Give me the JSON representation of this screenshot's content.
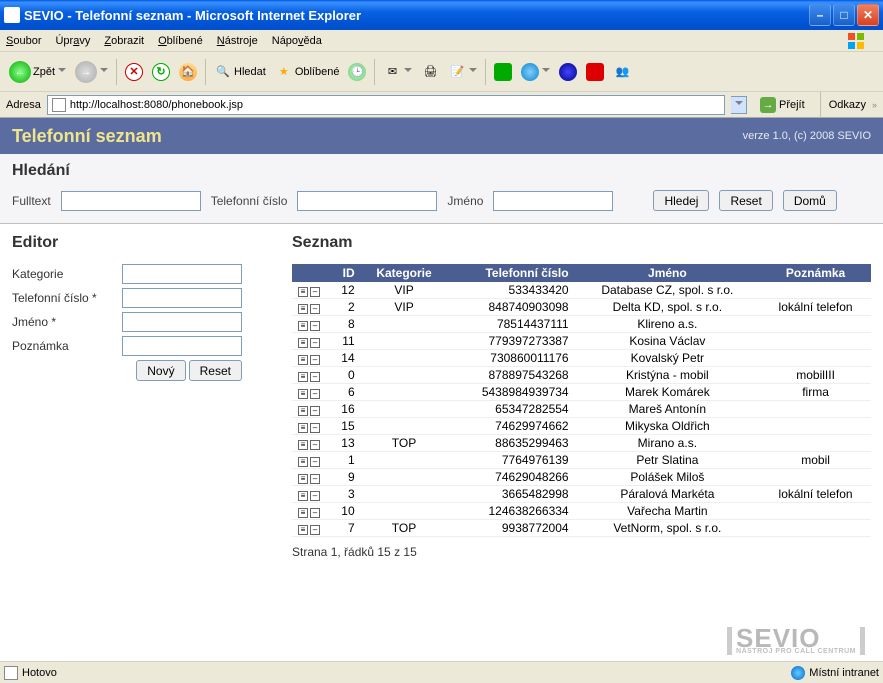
{
  "window": {
    "title": "SEVIO - Telefonní seznam - Microsoft Internet Explorer"
  },
  "menubar": {
    "items": [
      "Soubor",
      "Úpravy",
      "Zobrazit",
      "Oblíbené",
      "Nástroje",
      "Nápověda"
    ]
  },
  "toolbar": {
    "back": "Zpět",
    "search": "Hledat",
    "favorites": "Oblíbené"
  },
  "addressbar": {
    "label": "Adresa",
    "url": "http://localhost:8080/phonebook.jsp",
    "go": "Přejít",
    "links": "Odkazy"
  },
  "app": {
    "title": "Telefonní seznam",
    "version": "verze 1.0, (c) 2008 SEVIO"
  },
  "search": {
    "heading": "Hledání",
    "fulltext_label": "Fulltext",
    "phone_label": "Telefonní číslo",
    "name_label": "Jméno",
    "btn_search": "Hledej",
    "btn_reset": "Reset",
    "btn_home": "Domů"
  },
  "editor": {
    "heading": "Editor",
    "category_label": "Kategorie",
    "phone_label": "Telefonní číslo *",
    "name_label": "Jméno *",
    "note_label": "Poznámka",
    "btn_new": "Nový",
    "btn_reset": "Reset"
  },
  "list": {
    "heading": "Seznam",
    "columns": [
      "ID",
      "Kategorie",
      "Telefonní číslo",
      "Jméno",
      "Poznámka"
    ],
    "rows": [
      {
        "id": "12",
        "cat": "VIP",
        "phone": "533433420",
        "name": "Database CZ, spol. s r.o.",
        "note": ""
      },
      {
        "id": "2",
        "cat": "VIP",
        "phone": "848740903098",
        "name": "Delta KD, spol. s r.o.",
        "note": "lokální telefon"
      },
      {
        "id": "8",
        "cat": "",
        "phone": "78514437111",
        "name": "Klireno a.s.",
        "note": ""
      },
      {
        "id": "11",
        "cat": "",
        "phone": "779397273387",
        "name": "Kosina Václav",
        "note": ""
      },
      {
        "id": "14",
        "cat": "",
        "phone": "730860011176",
        "name": "Kovalský Petr",
        "note": ""
      },
      {
        "id": "0",
        "cat": "",
        "phone": "878897543268",
        "name": "Kristýna - mobil",
        "note": "mobilIII"
      },
      {
        "id": "6",
        "cat": "",
        "phone": "5438984939734",
        "name": "Marek Komárek",
        "note": "firma"
      },
      {
        "id": "16",
        "cat": "",
        "phone": "65347282554",
        "name": "Mareš Antonín",
        "note": ""
      },
      {
        "id": "15",
        "cat": "",
        "phone": "74629974662",
        "name": "Mikyska Oldřich",
        "note": ""
      },
      {
        "id": "13",
        "cat": "TOP",
        "phone": "88635299463",
        "name": "Mirano a.s.",
        "note": ""
      },
      {
        "id": "1",
        "cat": "",
        "phone": "7764976139",
        "name": "Petr Slatina",
        "note": "mobil"
      },
      {
        "id": "9",
        "cat": "",
        "phone": "74629048266",
        "name": "Polášek Miloš",
        "note": ""
      },
      {
        "id": "3",
        "cat": "",
        "phone": "3665482998",
        "name": "Páralová Markéta",
        "note": "lokální telefon"
      },
      {
        "id": "10",
        "cat": "",
        "phone": "124638266334",
        "name": "Vařecha Martin",
        "note": ""
      },
      {
        "id": "7",
        "cat": "TOP",
        "phone": "9938772004",
        "name": "VetNorm, spol. s r.o.",
        "note": ""
      }
    ],
    "pager": "Strana 1, řádků 15 z 15"
  },
  "logo": {
    "brand": "SEVIO",
    "tagline": "NÁSTROJ PRO CALL CENTRUM"
  },
  "statusbar": {
    "status": "Hotovo",
    "zone": "Místní intranet"
  }
}
